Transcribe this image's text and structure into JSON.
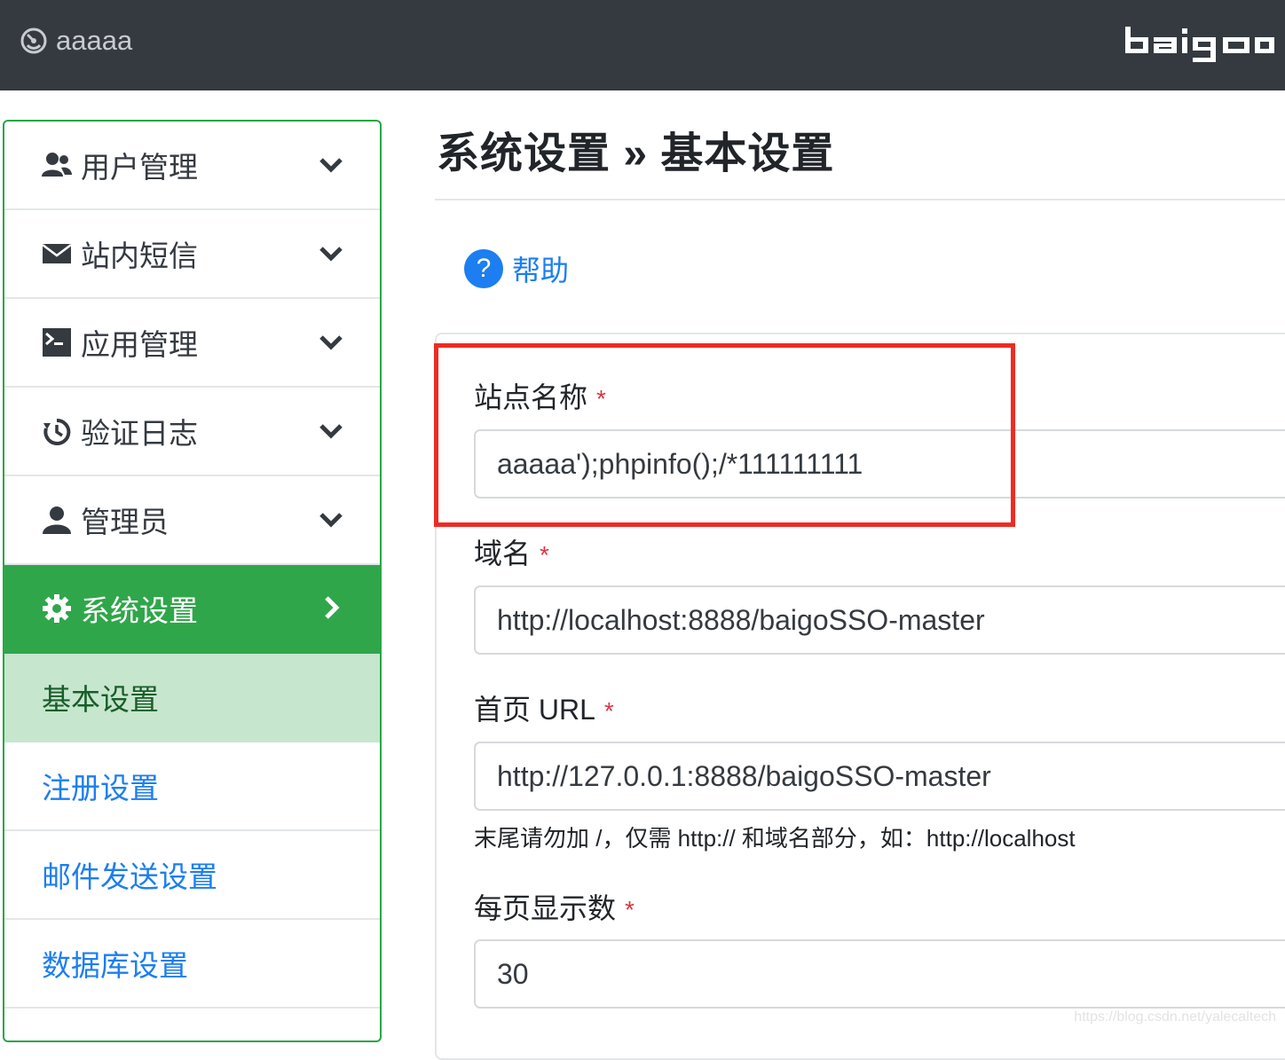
{
  "header": {
    "site_name": "aaaaa",
    "brand": "baigo"
  },
  "sidebar": {
    "items": [
      {
        "label": "用户管理",
        "icon": "users-icon"
      },
      {
        "label": "站内短信",
        "icon": "envelope-icon"
      },
      {
        "label": "应用管理",
        "icon": "terminal-icon"
      },
      {
        "label": "验证日志",
        "icon": "history-icon"
      },
      {
        "label": "管理员",
        "icon": "user-icon"
      },
      {
        "label": "系统设置",
        "icon": "gear-icon",
        "active": true
      }
    ],
    "subitems": [
      {
        "label": "基本设置",
        "current": true
      },
      {
        "label": "注册设置"
      },
      {
        "label": "邮件发送设置"
      },
      {
        "label": "数据库设置"
      }
    ]
  },
  "main": {
    "title": "系统设置 » 基本设置",
    "help_label": "帮助",
    "fields": [
      {
        "label": "站点名称",
        "required": "*",
        "value": "aaaaa');phpinfo();/*111111111"
      },
      {
        "label": "域名",
        "required": "*",
        "value": "http://localhost:8888/baigoSSO-master"
      },
      {
        "label": "首页 URL",
        "required": "*",
        "value": "http://127.0.0.1:8888/baigoSSO-master"
      },
      {
        "label": "每页显示数",
        "required": "*",
        "value": "30"
      }
    ],
    "hint": "末尾请勿加 /，仅需 http:// 和域名部分，如：http://localhost"
  },
  "watermark": "https://blog.csdn.net/yalecaltech",
  "colors": {
    "topbar": "#343a40",
    "active_green": "#30a64a",
    "current_bg": "#c6e6cd",
    "link_blue": "#1c7ef0",
    "required_red": "#dc3545",
    "annotation_red": "#ef2b22"
  }
}
